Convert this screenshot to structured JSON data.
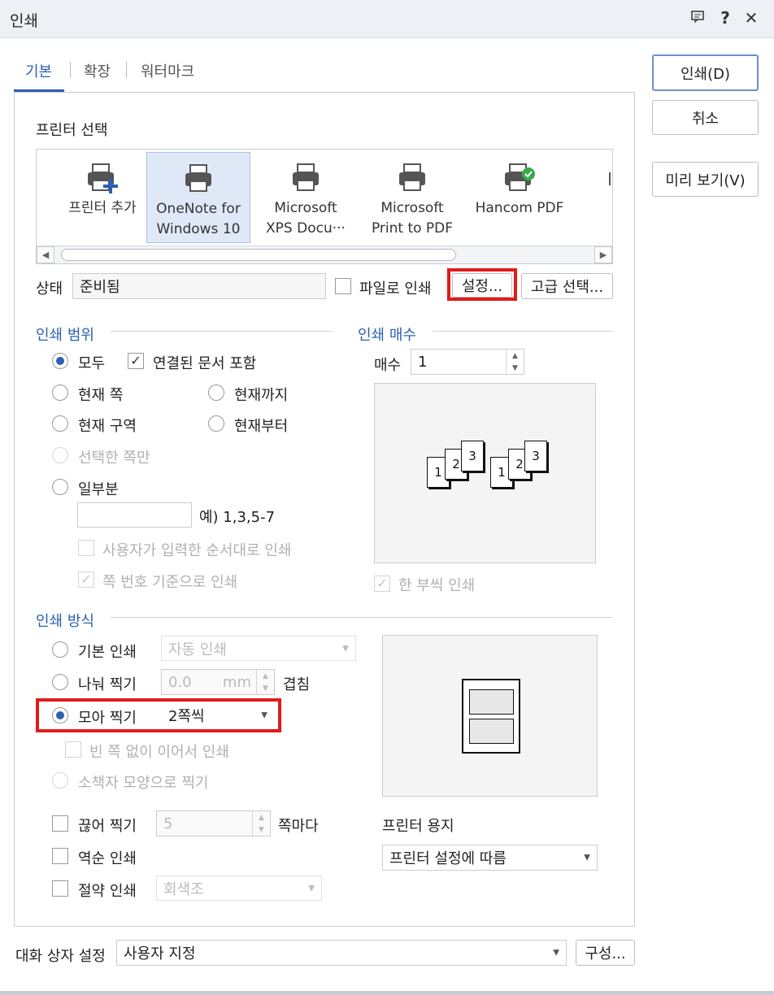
{
  "window": {
    "title": "인쇄"
  },
  "tabs": [
    {
      "label": "기본"
    },
    {
      "label": "확장"
    },
    {
      "label": "워터마크"
    }
  ],
  "side_buttons": {
    "print": "인쇄(D)",
    "cancel": "취소",
    "preview": "미리 보기(V)"
  },
  "printer_select": {
    "title": "프린터 선택",
    "items": [
      {
        "line1": "프린터 추가",
        "line2": "",
        "icon": "printer-add-icon"
      },
      {
        "line1": "OneNote for",
        "line2": "Windows 10",
        "icon": "printer-icon",
        "selected": true
      },
      {
        "line1": "Microsoft",
        "line2": "XPS Docu···",
        "icon": "printer-icon"
      },
      {
        "line1": "Microsoft",
        "line2": "Print to PDF",
        "icon": "printer-icon"
      },
      {
        "line1": "Hancom PDF",
        "line2": "",
        "icon": "printer-check-icon"
      }
    ],
    "status_label": "상태",
    "status_value": "준비됨",
    "print_to_file": "파일로 인쇄",
    "settings": "설정...",
    "advanced": "고급 선택..."
  },
  "print_range": {
    "title": "인쇄 범위",
    "all": "모두",
    "include_linked": "연결된 문서 포함",
    "current_page": "현재 쪽",
    "until_current": "현재까지",
    "current_section": "현재 구역",
    "from_current": "현재부터",
    "selected_pages": "선택한 쪽만",
    "partial": "일부분",
    "example": "예) 1,3,5-7",
    "user_order": "사용자가 입력한 순서대로 인쇄",
    "by_page_number": "쪽 번호 기준으로 인쇄"
  },
  "copies": {
    "title": "인쇄 매수",
    "label": "매수",
    "value": "1",
    "collate": "한 부씩 인쇄",
    "sheet_numbers": [
      "1",
      "2",
      "3"
    ]
  },
  "print_method": {
    "title": "인쇄 방식",
    "basic": "기본 인쇄",
    "basic_select": "자동 인쇄",
    "split": "나눠 찍기",
    "split_value": "0.0",
    "split_unit": "mm",
    "overlap": "겹침",
    "nup": "모아 찍기",
    "nup_select": "2쪽씩",
    "no_blank": "빈 쪽 없이 이어서 인쇄",
    "booklet": "소책자 모양으로 찍기",
    "cut": "끊어 찍기",
    "cut_value": "5",
    "cut_suffix": "쪽마다",
    "reverse": "역순 인쇄",
    "save": "절약 인쇄",
    "save_select": "회색조"
  },
  "paper": {
    "title": "프린터 용지",
    "select": "프린터 설정에 따름"
  },
  "dialog_settings": {
    "label": "대화 상자 설정",
    "select": "사용자 지정",
    "configure": "구성..."
  }
}
